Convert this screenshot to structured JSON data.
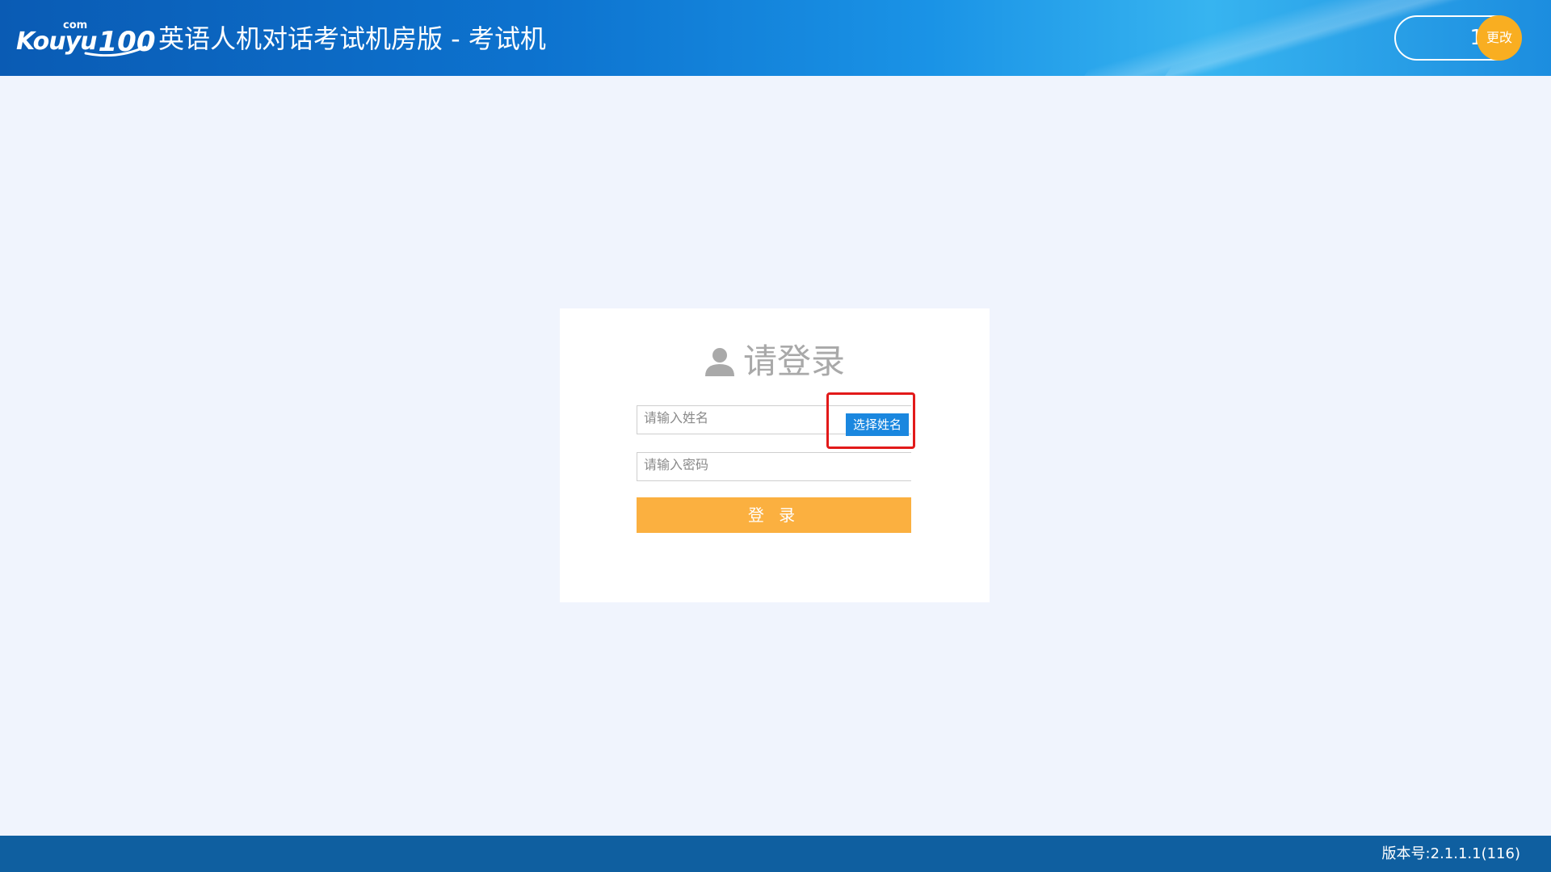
{
  "header": {
    "logo_main": "Kouyu",
    "logo_com": "com",
    "logo_num": "100",
    "title": "英语人机对话考试机房版 - 考试机",
    "station_number": "1",
    "change_label": "更改"
  },
  "login": {
    "title": "请登录",
    "name_placeholder": "请输入姓名",
    "select_name_label": "选择姓名",
    "password_placeholder": "请输入密码",
    "submit_label": "登 录"
  },
  "footer": {
    "version": "版本号:2.1.1.1(116)"
  },
  "colors": {
    "header_blue": "#0d73cf",
    "accent_orange": "#fbb040",
    "button_blue": "#1a87df",
    "highlight_red": "#e21a1a",
    "footer_blue": "#0f5fa0",
    "background": "#f0f4fd"
  }
}
